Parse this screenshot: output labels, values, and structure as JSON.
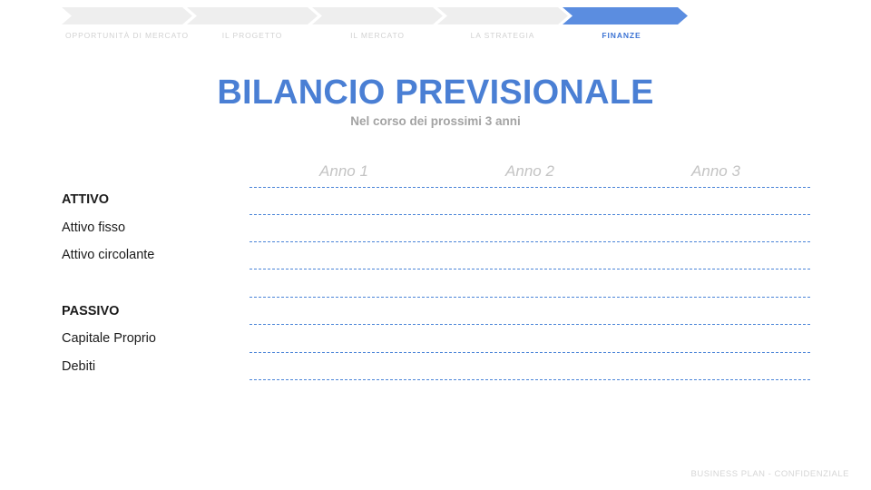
{
  "nav": {
    "items": [
      {
        "label": "OPPORTUNITÀ DI MERCATO",
        "active": false
      },
      {
        "label": "IL PROGETTO",
        "active": false
      },
      {
        "label": "IL MERCATO",
        "active": false
      },
      {
        "label": "LA STRATEGIA",
        "active": false
      },
      {
        "label": "FINANZE",
        "active": true
      }
    ],
    "inactive_color": "#eeeeee",
    "active_color": "#5b8de0",
    "inactive_label_color": "#d2d2d2",
    "active_label_color": "#3d74d4"
  },
  "header": {
    "title": "BILANCIO PREVISIONALE",
    "subtitle": "Nel corso dei prossimi 3 anni",
    "title_color": "#4a7fd4",
    "subtitle_color": "#a3a3a3"
  },
  "table": {
    "columns": [
      "Anno 1",
      "Anno 2",
      "Anno 3"
    ],
    "column_color": "#c4c4c4",
    "line_color": "#4a84d8",
    "line_count": 8,
    "sections": [
      {
        "heading": "ATTIVO",
        "rows": [
          "Attivo fisso",
          "Attivo circolante"
        ]
      },
      {
        "heading": "PASSIVO",
        "rows": [
          "Capitale Proprio",
          "Debiti"
        ]
      }
    ]
  },
  "footer": {
    "text": "BUSINESS PLAN - CONFIDENZIALE",
    "color": "#d6d6d6"
  }
}
